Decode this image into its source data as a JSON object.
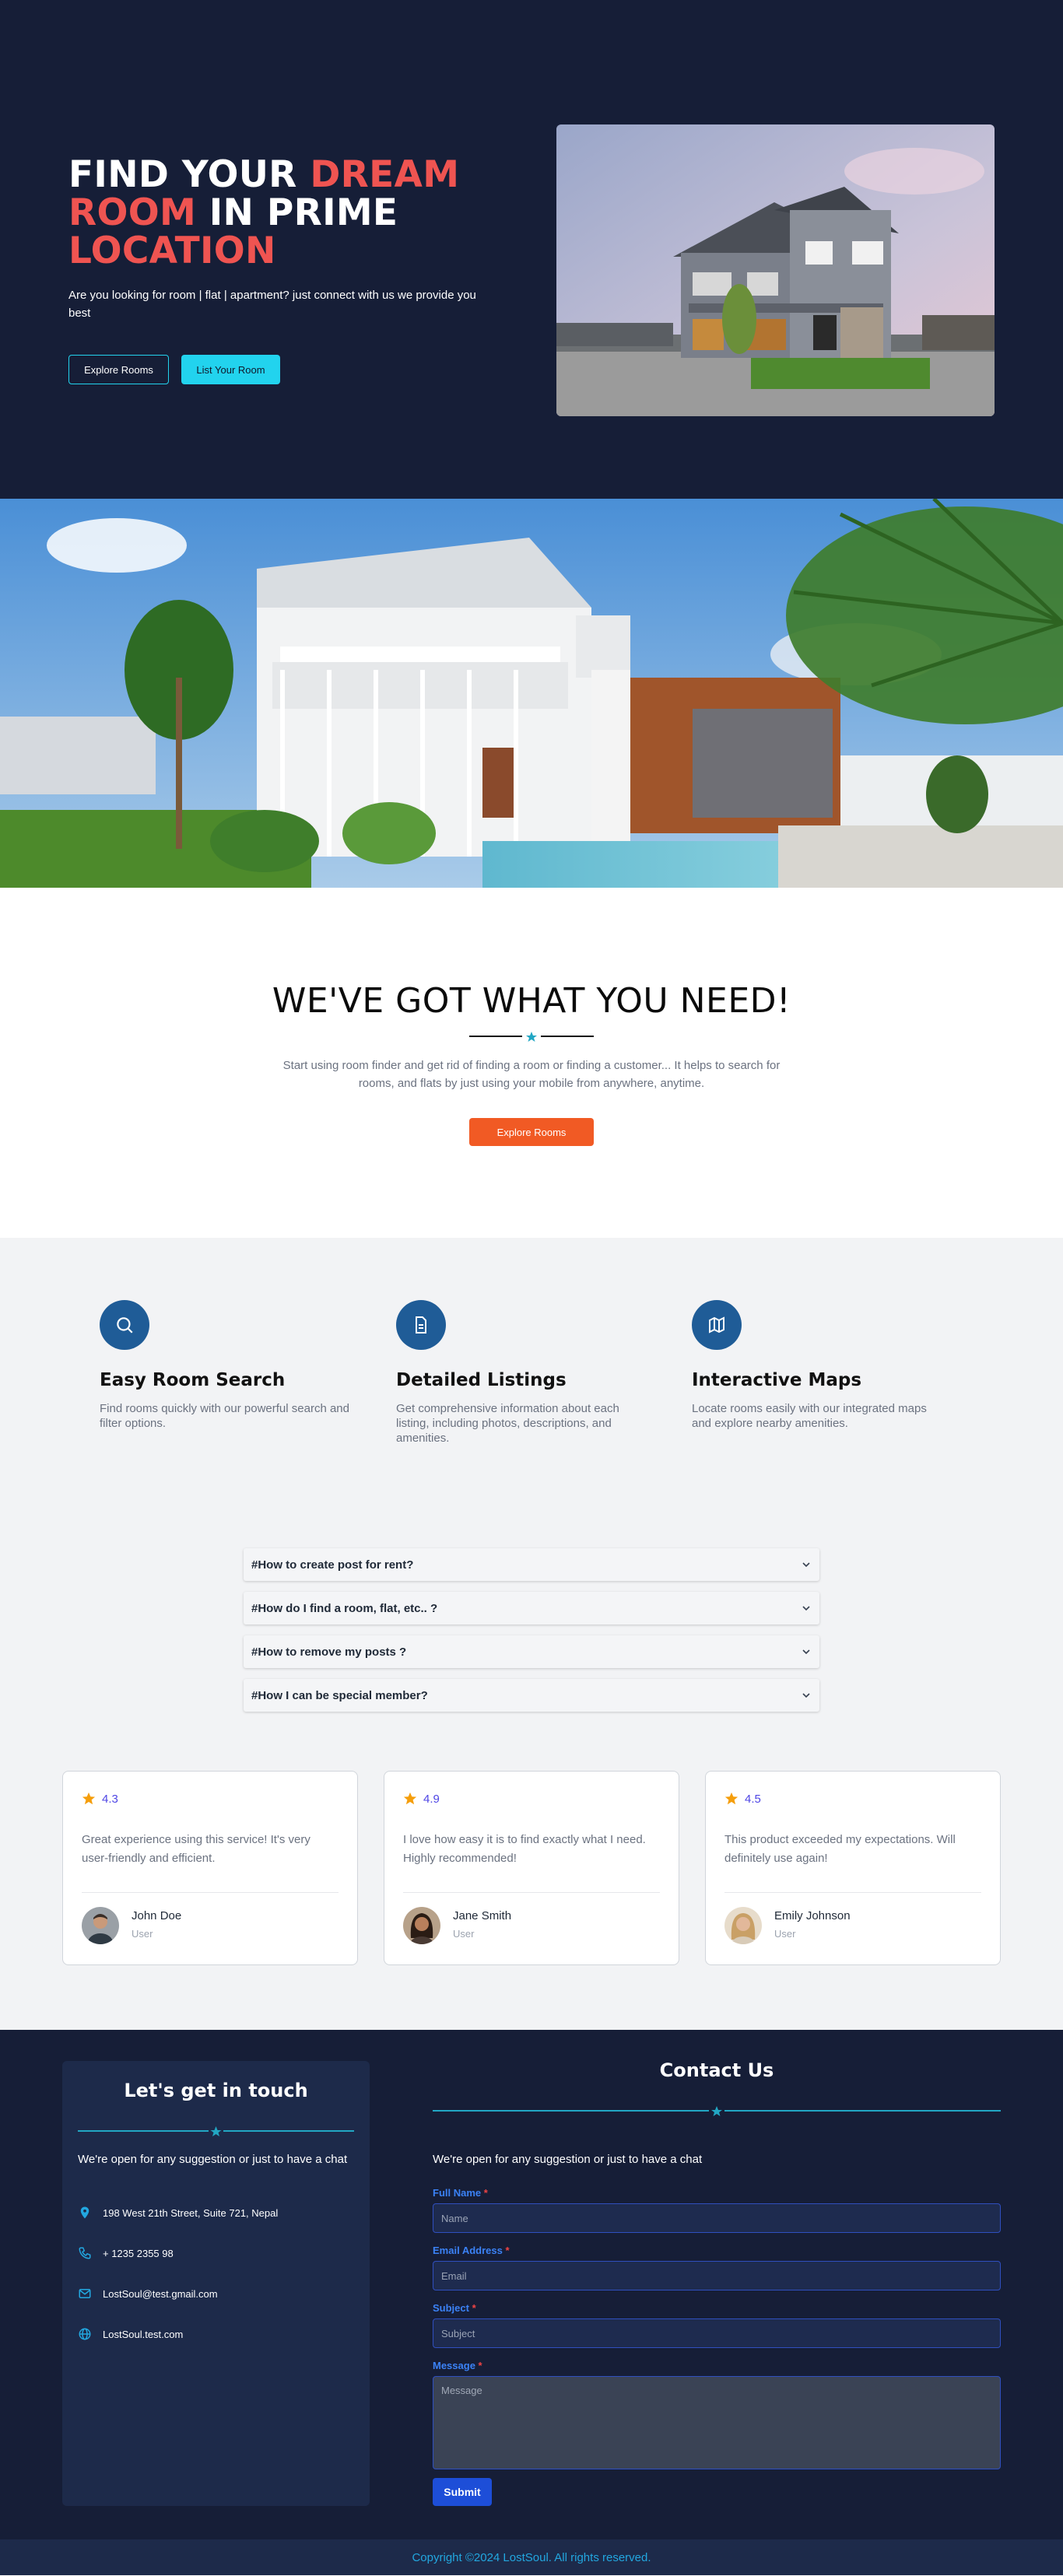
{
  "hero": {
    "title_part1": "FIND YOUR ",
    "title_accent1": "DREAM ROOM",
    "title_part2": " IN PRIME ",
    "title_accent2": "LOCATION",
    "subtitle": "Are you looking for room | flat | apartment? just connect with us we provide you best",
    "explore_button": "Explore Rooms",
    "list_button": "List Your Room"
  },
  "need": {
    "title": "WE'VE GOT WHAT YOU NEED!",
    "text": "Start using room finder and get rid of finding a room or finding a customer... It helps to search for rooms, and flats by just using your mobile from anywhere, anytime.",
    "button": "Explore Rooms"
  },
  "features": [
    {
      "icon": "search-icon",
      "title": "Easy Room Search",
      "text": "Find rooms quickly with our powerful search and filter options."
    },
    {
      "icon": "document-icon",
      "title": "Detailed Listings",
      "text": "Get comprehensive information about each listing, including photos, descriptions, and amenities."
    },
    {
      "icon": "map-icon",
      "title": "Interactive Maps",
      "text": "Locate rooms easily with our integrated maps and explore nearby amenities."
    }
  ],
  "faq": [
    "#How to create post for rent?",
    "#How do I find a room, flat, etc.. ?",
    "#How to remove my posts ?",
    "#How I can be special member?"
  ],
  "reviews": [
    {
      "rating": "4.3",
      "text": "Great experience using this service! It's very user-friendly and efficient.",
      "name": "John Doe",
      "role": "User"
    },
    {
      "rating": "4.9",
      "text": "I love how easy it is to find exactly what I need. Highly recommended!",
      "name": "Jane Smith",
      "role": "User"
    },
    {
      "rating": "4.5",
      "text": "This product exceeded my expectations. Will definitely use again!",
      "name": "Emily Johnson",
      "role": "User"
    }
  ],
  "touch": {
    "title": "Let's get in touch",
    "intro": "We're open for any suggestion or just to have a chat",
    "address": "198 West 21th Street, Suite 721, Nepal",
    "phone": "+ 1235 2355 98",
    "email": "LostSoul@test.gmail.com",
    "website": "LostSoul.test.com"
  },
  "contact_form": {
    "title": "Contact Us",
    "intro": "We're open for any suggestion or just to have a chat",
    "name_label": "Full Name",
    "name_placeholder": "Name",
    "email_label": "Email Address",
    "email_placeholder": "Email",
    "subject_label": "Subject",
    "subject_placeholder": "Subject",
    "message_label": "Message",
    "message_placeholder": "Message",
    "required_mark": "*",
    "submit": "Submit"
  },
  "footer": {
    "text": "Copyright ©2024 LostSoul. All rights reserved."
  },
  "colors": {
    "navy": "#161e37",
    "accent_red": "#ef5451",
    "cyan": "#22d3ee",
    "orange": "#f15a24",
    "icon_blue": "#1f5c97"
  }
}
